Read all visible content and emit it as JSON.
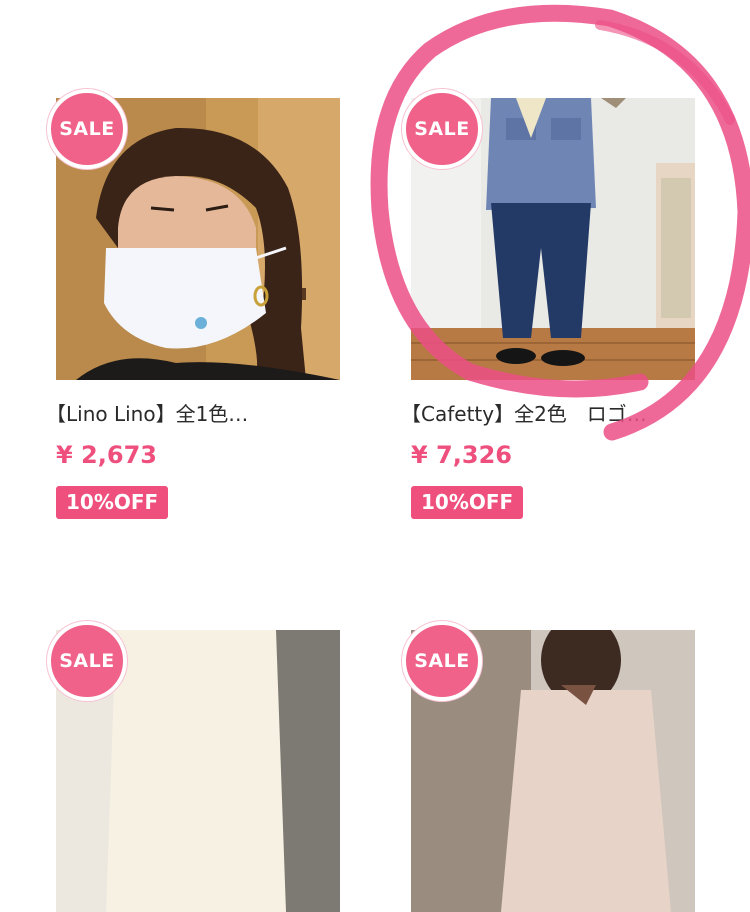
{
  "products": [
    {
      "badge": "SALE",
      "name": "【Lino Lino】全1色…",
      "price": "¥ 2,673",
      "discount": "10%OFF",
      "image": "woman-wearing-white-mask"
    },
    {
      "badge": "SALE",
      "name": "【Cafetty】全2色　ロゴ…",
      "price": "¥ 7,326",
      "discount": "10%OFF",
      "image": "person-in-blue-jacket-and-jeans"
    },
    {
      "badge": "SALE",
      "image": "cream-sweater"
    },
    {
      "badge": "SALE",
      "image": "woman-in-beige-top"
    }
  ],
  "colors": {
    "accent": "#ee4f7c",
    "badge": "#f0628a",
    "annotation": "#ec4f86"
  }
}
